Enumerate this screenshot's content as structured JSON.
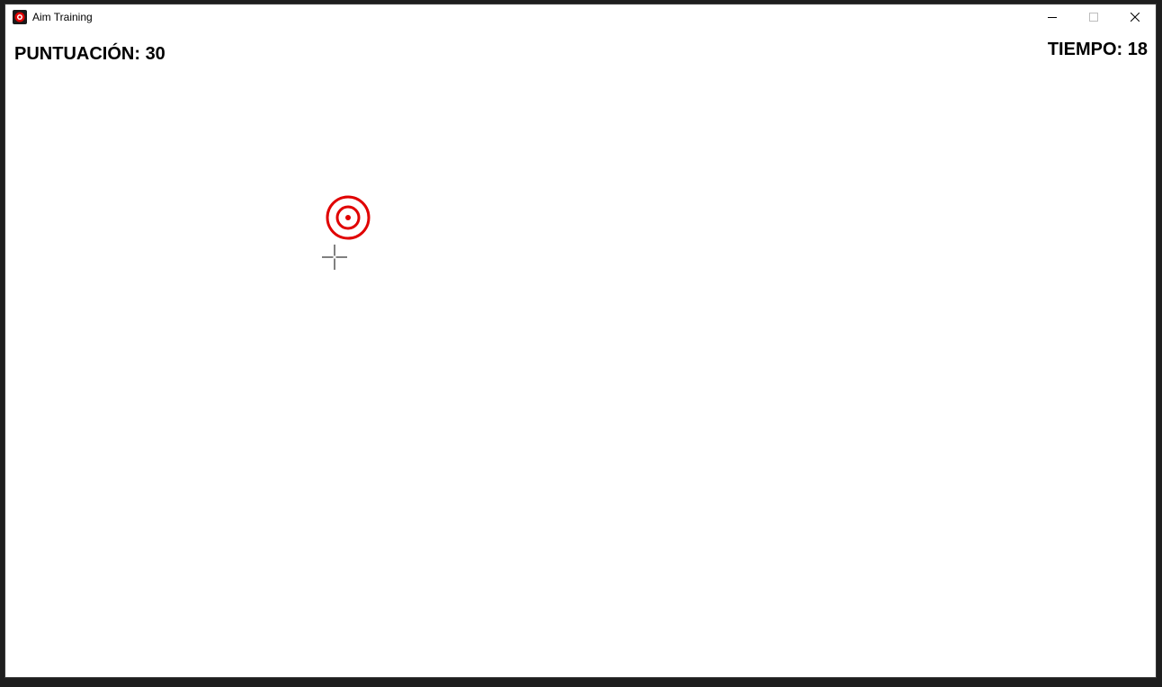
{
  "window": {
    "title": "Aim Training"
  },
  "hud": {
    "score_label": "PUNTUACIÓN:",
    "score_value": "30",
    "time_label": "TIEMPO:",
    "time_value": "18"
  },
  "icons": {
    "app": "target-icon",
    "minimize": "minimize-icon",
    "maximize": "maximize-icon",
    "close": "close-icon",
    "cursor": "crosshair-cursor-icon"
  },
  "colors": {
    "target": "#e00000",
    "background": "#ffffff",
    "text": "#000000"
  }
}
